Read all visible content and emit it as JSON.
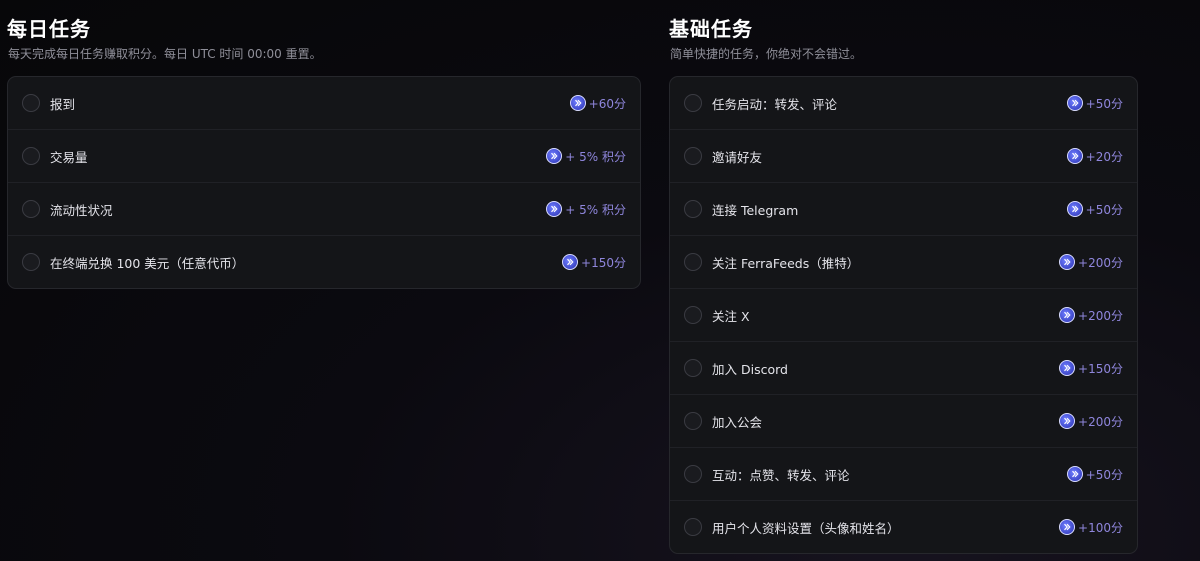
{
  "daily": {
    "title": "每日任务",
    "subtitle": "每天完成每日任务赚取积分。每日 UTC 时间 00:00 重置。",
    "tasks": [
      {
        "label": "报到",
        "reward": "+60分"
      },
      {
        "label": "交易量",
        "reward": "+ 5% 积分"
      },
      {
        "label": "流动性状况",
        "reward": "+ 5% 积分"
      },
      {
        "label": "在终端兑换 100 美元（任意代币）",
        "reward": "+150分"
      }
    ]
  },
  "basic": {
    "title": "基础任务",
    "subtitle": "简单快捷的任务，你绝对不会错过。",
    "tasks": [
      {
        "label": "任务启动：转发、评论",
        "reward": "+50分"
      },
      {
        "label": "邀请好友",
        "reward": "+20分"
      },
      {
        "label": "连接 Telegram",
        "reward": "+50分"
      },
      {
        "label": "关注 FerraFeeds（推特）",
        "reward": "+200分"
      },
      {
        "label": "关注 X",
        "reward": "+200分"
      },
      {
        "label": "加入 Discord",
        "reward": "+150分"
      },
      {
        "label": "加入公会",
        "reward": "+200分"
      },
      {
        "label": "互动：点赞、转发、评论",
        "reward": "+50分"
      },
      {
        "label": "用户个人资料设置（头像和姓名）",
        "reward": "+100分"
      }
    ]
  },
  "icons": {
    "task_checkbox": "empty-circle",
    "reward_coin": "points-coin-icon"
  },
  "colors": {
    "background": "#08080b",
    "card": "#141518",
    "reward_text": "#8f86dc",
    "coin": "#4b56e0"
  }
}
